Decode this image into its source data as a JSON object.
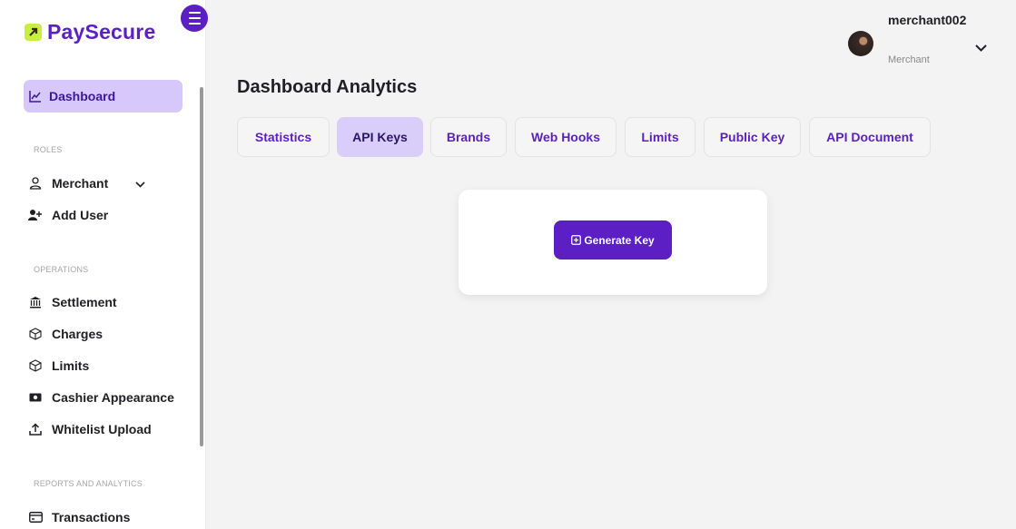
{
  "brand": {
    "name": "PaySecure",
    "accent": "#5b1fc4",
    "logo_mark_color": "#c6ef3f"
  },
  "sidebar": {
    "active_item": {
      "label": "Dashboard",
      "icon": "chart-line-icon"
    },
    "sections": [
      {
        "label": "ROLES"
      },
      {
        "label": "OPERATIONS"
      },
      {
        "label": "REPORTS AND ANALYTICS"
      }
    ],
    "items": [
      {
        "label": "Merchant",
        "icon": "user-icon"
      },
      {
        "label": "Add User",
        "icon": "add-user-icon"
      },
      {
        "label": "Settlement",
        "icon": "bank-icon"
      },
      {
        "label": "Charges",
        "icon": "cube-icon"
      },
      {
        "label": "Limits",
        "icon": "cube-icon"
      },
      {
        "label": "Cashier Appearance",
        "icon": "money-icon"
      },
      {
        "label": "Whitelist Upload",
        "icon": "upload-icon"
      },
      {
        "label": "Transactions",
        "icon": "card-icon"
      }
    ]
  },
  "header": {
    "user_name": "merchant002",
    "user_role": "Merchant"
  },
  "main": {
    "title": "Dashboard Analytics",
    "tabs": [
      {
        "label": "Statistics"
      },
      {
        "label": "API Keys"
      },
      {
        "label": "Brands"
      },
      {
        "label": "Web Hooks"
      },
      {
        "label": "Limits"
      },
      {
        "label": "Public Key"
      },
      {
        "label": "API Document"
      }
    ],
    "active_tab": "API Keys",
    "generate_button": "Generate Key"
  }
}
